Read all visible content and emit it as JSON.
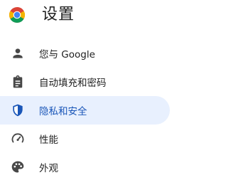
{
  "header": {
    "title": "设置",
    "logo_icon": "chrome-logo-icon"
  },
  "sidebar": {
    "items": [
      {
        "label": "您与 Google",
        "icon": "person-icon",
        "active": false
      },
      {
        "label": "自动填充和密码",
        "icon": "clipboard-icon",
        "active": false
      },
      {
        "label": "隐私和安全",
        "icon": "shield-icon",
        "active": true
      },
      {
        "label": "性能",
        "icon": "speedometer-icon",
        "active": false
      },
      {
        "label": "外观",
        "icon": "palette-icon",
        "active": false
      }
    ]
  },
  "colors": {
    "active_background": "#e8f0fe",
    "active_text": "#1a56b8",
    "icon_gray": "#474747",
    "icon_active_blue": "#1a56b8"
  }
}
